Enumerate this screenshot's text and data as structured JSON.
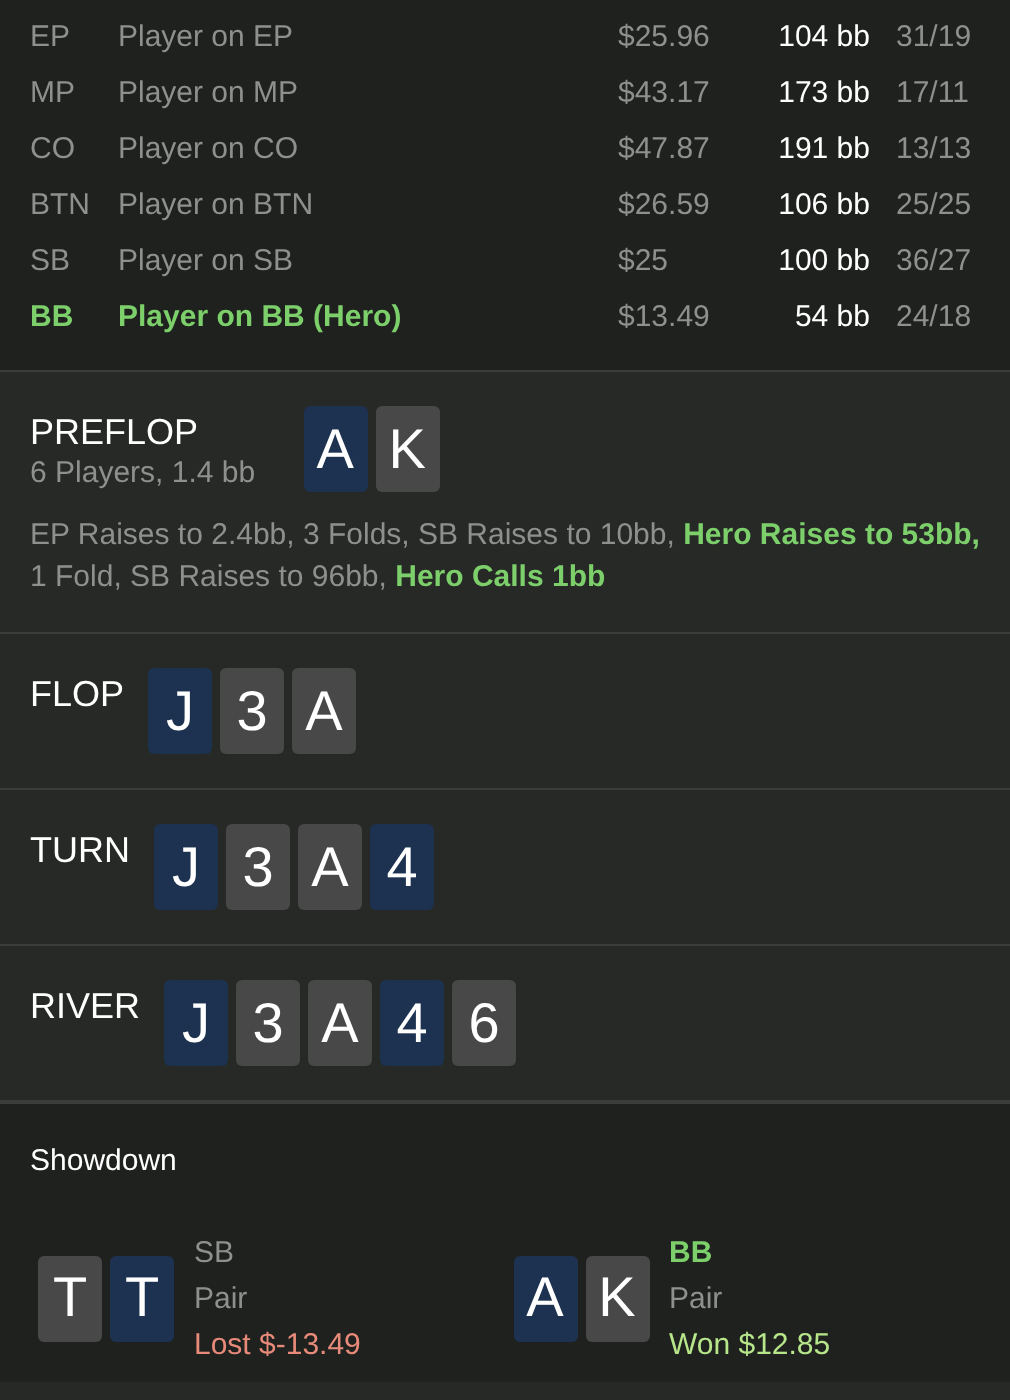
{
  "players": [
    {
      "position": "EP",
      "name": "Player on EP",
      "stack": "$25.96",
      "bb": "104 bb",
      "stats": "31/19",
      "hero": false
    },
    {
      "position": "MP",
      "name": "Player on MP",
      "stack": "$43.17",
      "bb": "173 bb",
      "stats": "17/11",
      "hero": false
    },
    {
      "position": "CO",
      "name": "Player on CO",
      "stack": "$47.87",
      "bb": "191 bb",
      "stats": "13/13",
      "hero": false
    },
    {
      "position": "BTN",
      "name": "Player on BTN",
      "stack": "$26.59",
      "bb": "106 bb",
      "stats": "25/25",
      "hero": false
    },
    {
      "position": "SB",
      "name": "Player on SB",
      "stack": "$25",
      "bb": "100 bb",
      "stats": "36/27",
      "hero": false
    },
    {
      "position": "BB",
      "name": "Player on BB (Hero)",
      "stack": "$13.49",
      "bb": "54 bb",
      "stats": "24/18",
      "hero": true
    }
  ],
  "streets": [
    {
      "title": "PREFLOP",
      "subtitle": "6 Players, 1.4 bb",
      "cards": [
        {
          "rank": "A",
          "color": "#1c3250"
        },
        {
          "rank": "K",
          "color": "#484848"
        }
      ],
      "actions": "EP Raises to 2.4bb, 3 Folds, SB Raises to 10bb, **Hero Raises to 53bb,** 1 Fold, SB Raises to 96bb, **Hero Calls 1bb**"
    },
    {
      "title": "FLOP",
      "cards": [
        {
          "rank": "J",
          "color": "#1c3250"
        },
        {
          "rank": "3",
          "color": "#484848"
        },
        {
          "rank": "A",
          "color": "#484848"
        }
      ]
    },
    {
      "title": "TURN",
      "cards": [
        {
          "rank": "J",
          "color": "#1c3250"
        },
        {
          "rank": "3",
          "color": "#484848"
        },
        {
          "rank": "A",
          "color": "#484848"
        },
        {
          "rank": "4",
          "color": "#1c3250"
        }
      ]
    },
    {
      "title": "RIVER",
      "cards": [
        {
          "rank": "J",
          "color": "#1c3250"
        },
        {
          "rank": "3",
          "color": "#484848"
        },
        {
          "rank": "A",
          "color": "#484848"
        },
        {
          "rank": "4",
          "color": "#1c3250"
        },
        {
          "rank": "6",
          "color": "#484848"
        }
      ]
    }
  ],
  "showdown": {
    "title": "Showdown",
    "hands": [
      {
        "cards": [
          {
            "rank": "T",
            "color": "#484848"
          },
          {
            "rank": "T",
            "color": "#1c3250"
          }
        ],
        "position": "SB",
        "hero": false,
        "hand": "Pair",
        "result": "Lost $-13.49",
        "kind": "lost"
      },
      {
        "cards": [
          {
            "rank": "A",
            "color": "#1c3250"
          },
          {
            "rank": "K",
            "color": "#484848"
          }
        ],
        "position": "BB",
        "hero": true,
        "hand": "Pair",
        "result": "Won $12.85",
        "kind": "won"
      }
    ]
  }
}
